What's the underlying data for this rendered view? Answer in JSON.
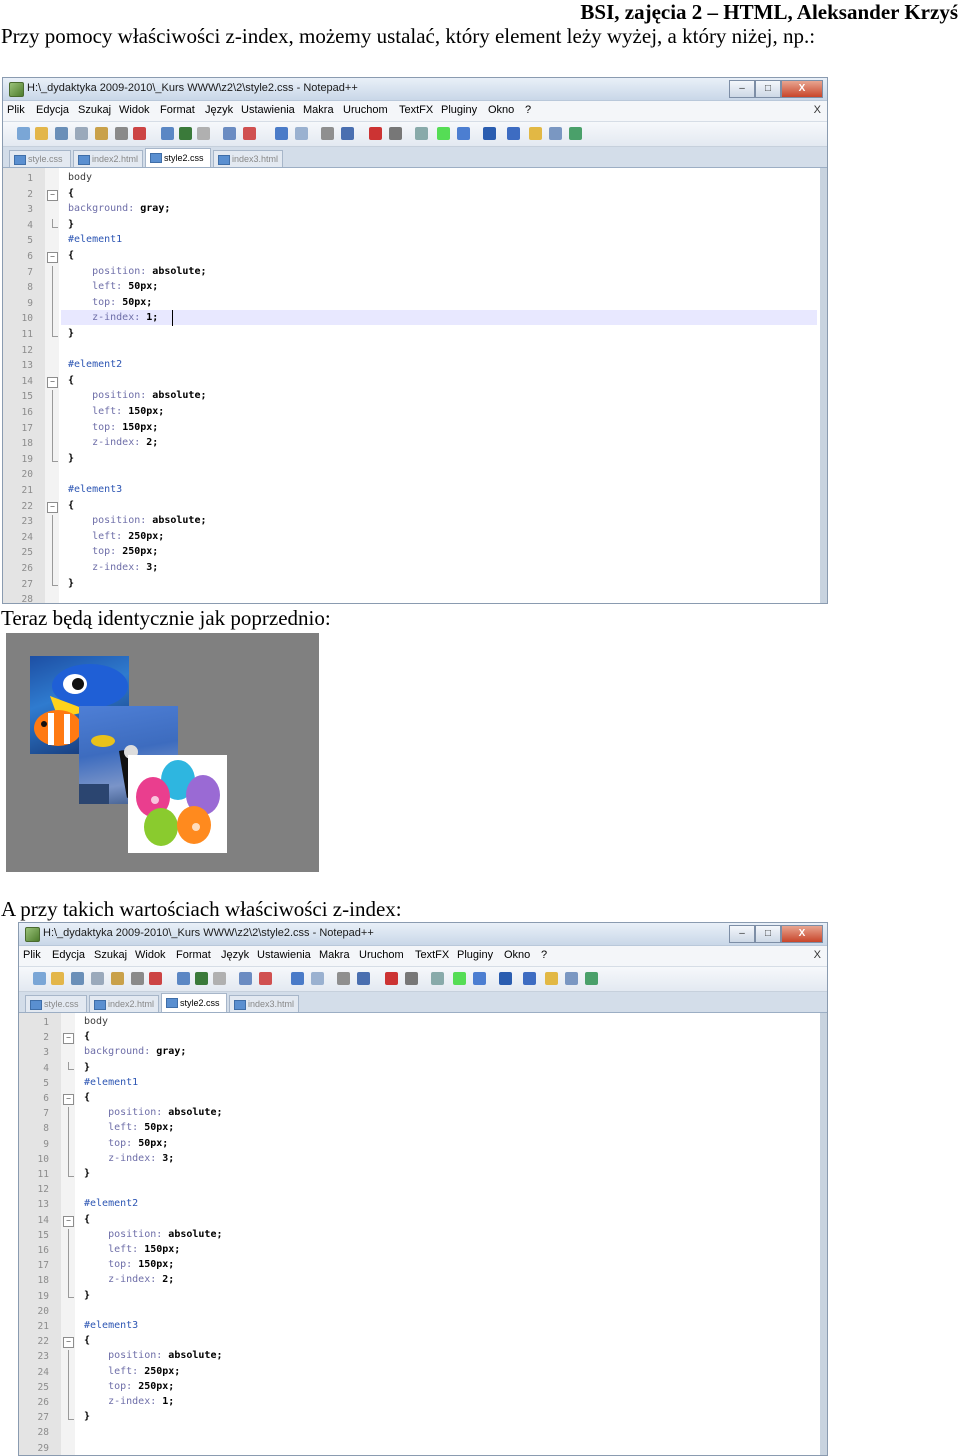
{
  "header": {
    "title": "BSI, zajęcia 2 – HTML, Aleksander Krzyś"
  },
  "paragraphs": {
    "intro": "Przy pomocy właściwości z-index, możemy ustalać, który element leży wyżej, a który niżej, np.:",
    "same": "Teraz będą identycznie jak poprzednio:",
    "other": "A przy takich wartościach właściwości z-index:"
  },
  "window": {
    "title": "H:\\_dydaktyka 2009-2010\\_Kurs WWW\\z2\\2\\style2.css - Notepad++",
    "buttons": {
      "minimize": "–",
      "maximize": "□",
      "close": "X"
    },
    "menu_close": "X",
    "menu": [
      "Plik",
      "Edycja",
      "Szukaj",
      "Widok",
      "Format",
      "Język",
      "Ustawienia",
      "Makra",
      "Uruchom",
      "TextFX",
      "Pluginy",
      "Okno",
      "?"
    ],
    "tabs": [
      "style.css",
      "index2.html",
      "style2.css",
      "index3.html"
    ],
    "active_tab": 2
  },
  "code1": [
    {
      "n": "1",
      "t": "body"
    },
    {
      "n": "2",
      "t": "{"
    },
    {
      "n": "3",
      "t": "background: gray;"
    },
    {
      "n": "4",
      "t": "}"
    },
    {
      "n": "5",
      "t": "#element1"
    },
    {
      "n": "6",
      "t": "{"
    },
    {
      "n": "7",
      "t": "    position: absolute;"
    },
    {
      "n": "8",
      "t": "    left: 50px;"
    },
    {
      "n": "9",
      "t": "    top: 50px;"
    },
    {
      "n": "10",
      "t": "    z-index: 1;"
    },
    {
      "n": "11",
      "t": "}"
    },
    {
      "n": "12",
      "t": ""
    },
    {
      "n": "13",
      "t": "#element2"
    },
    {
      "n": "14",
      "t": "{"
    },
    {
      "n": "15",
      "t": "    position: absolute;"
    },
    {
      "n": "16",
      "t": "    left: 150px;"
    },
    {
      "n": "17",
      "t": "    top: 150px;"
    },
    {
      "n": "18",
      "t": "    z-index: 2;"
    },
    {
      "n": "19",
      "t": "}"
    },
    {
      "n": "20",
      "t": ""
    },
    {
      "n": "21",
      "t": "#element3"
    },
    {
      "n": "22",
      "t": "{"
    },
    {
      "n": "23",
      "t": "    position: absolute;"
    },
    {
      "n": "24",
      "t": "    left: 250px;"
    },
    {
      "n": "25",
      "t": "    top: 250px;"
    },
    {
      "n": "26",
      "t": "    z-index: 3;"
    },
    {
      "n": "27",
      "t": "}"
    },
    {
      "n": "28",
      "t": ""
    }
  ],
  "code2": [
    {
      "n": "1",
      "t": "body"
    },
    {
      "n": "2",
      "t": "{"
    },
    {
      "n": "3",
      "t": "background: gray;"
    },
    {
      "n": "4",
      "t": "}"
    },
    {
      "n": "5",
      "t": "#element1"
    },
    {
      "n": "6",
      "t": "{"
    },
    {
      "n": "7",
      "t": "    position: absolute;"
    },
    {
      "n": "8",
      "t": "    left: 50px;"
    },
    {
      "n": "9",
      "t": "    top: 50px;"
    },
    {
      "n": "10",
      "t": "    z-index: 3;"
    },
    {
      "n": "11",
      "t": "}"
    },
    {
      "n": "12",
      "t": ""
    },
    {
      "n": "13",
      "t": "#element2"
    },
    {
      "n": "14",
      "t": "{"
    },
    {
      "n": "15",
      "t": "    position: absolute;"
    },
    {
      "n": "16",
      "t": "    left: 150px;"
    },
    {
      "n": "17",
      "t": "    top: 150px;"
    },
    {
      "n": "18",
      "t": "    z-index: 2;"
    },
    {
      "n": "19",
      "t": "}"
    },
    {
      "n": "20",
      "t": ""
    },
    {
      "n": "21",
      "t": "#element3"
    },
    {
      "n": "22",
      "t": "{"
    },
    {
      "n": "23",
      "t": "    position: absolute;"
    },
    {
      "n": "24",
      "t": "    left: 250px;"
    },
    {
      "n": "25",
      "t": "    top: 250px;"
    },
    {
      "n": "26",
      "t": "    z-index: 1;"
    },
    {
      "n": "27",
      "t": "}"
    },
    {
      "n": "28",
      "t": ""
    },
    {
      "n": "29",
      "t": ""
    }
  ],
  "demo": {
    "background": "#808080",
    "images": [
      "fish-image",
      "diver-image",
      "balloons-image"
    ]
  },
  "colors": {
    "selector": "#3c3c3c",
    "id_selector": "#2c55b3",
    "property": "#6e6ea8",
    "value": "#000000",
    "line_highlight": "#e8e8ff"
  }
}
